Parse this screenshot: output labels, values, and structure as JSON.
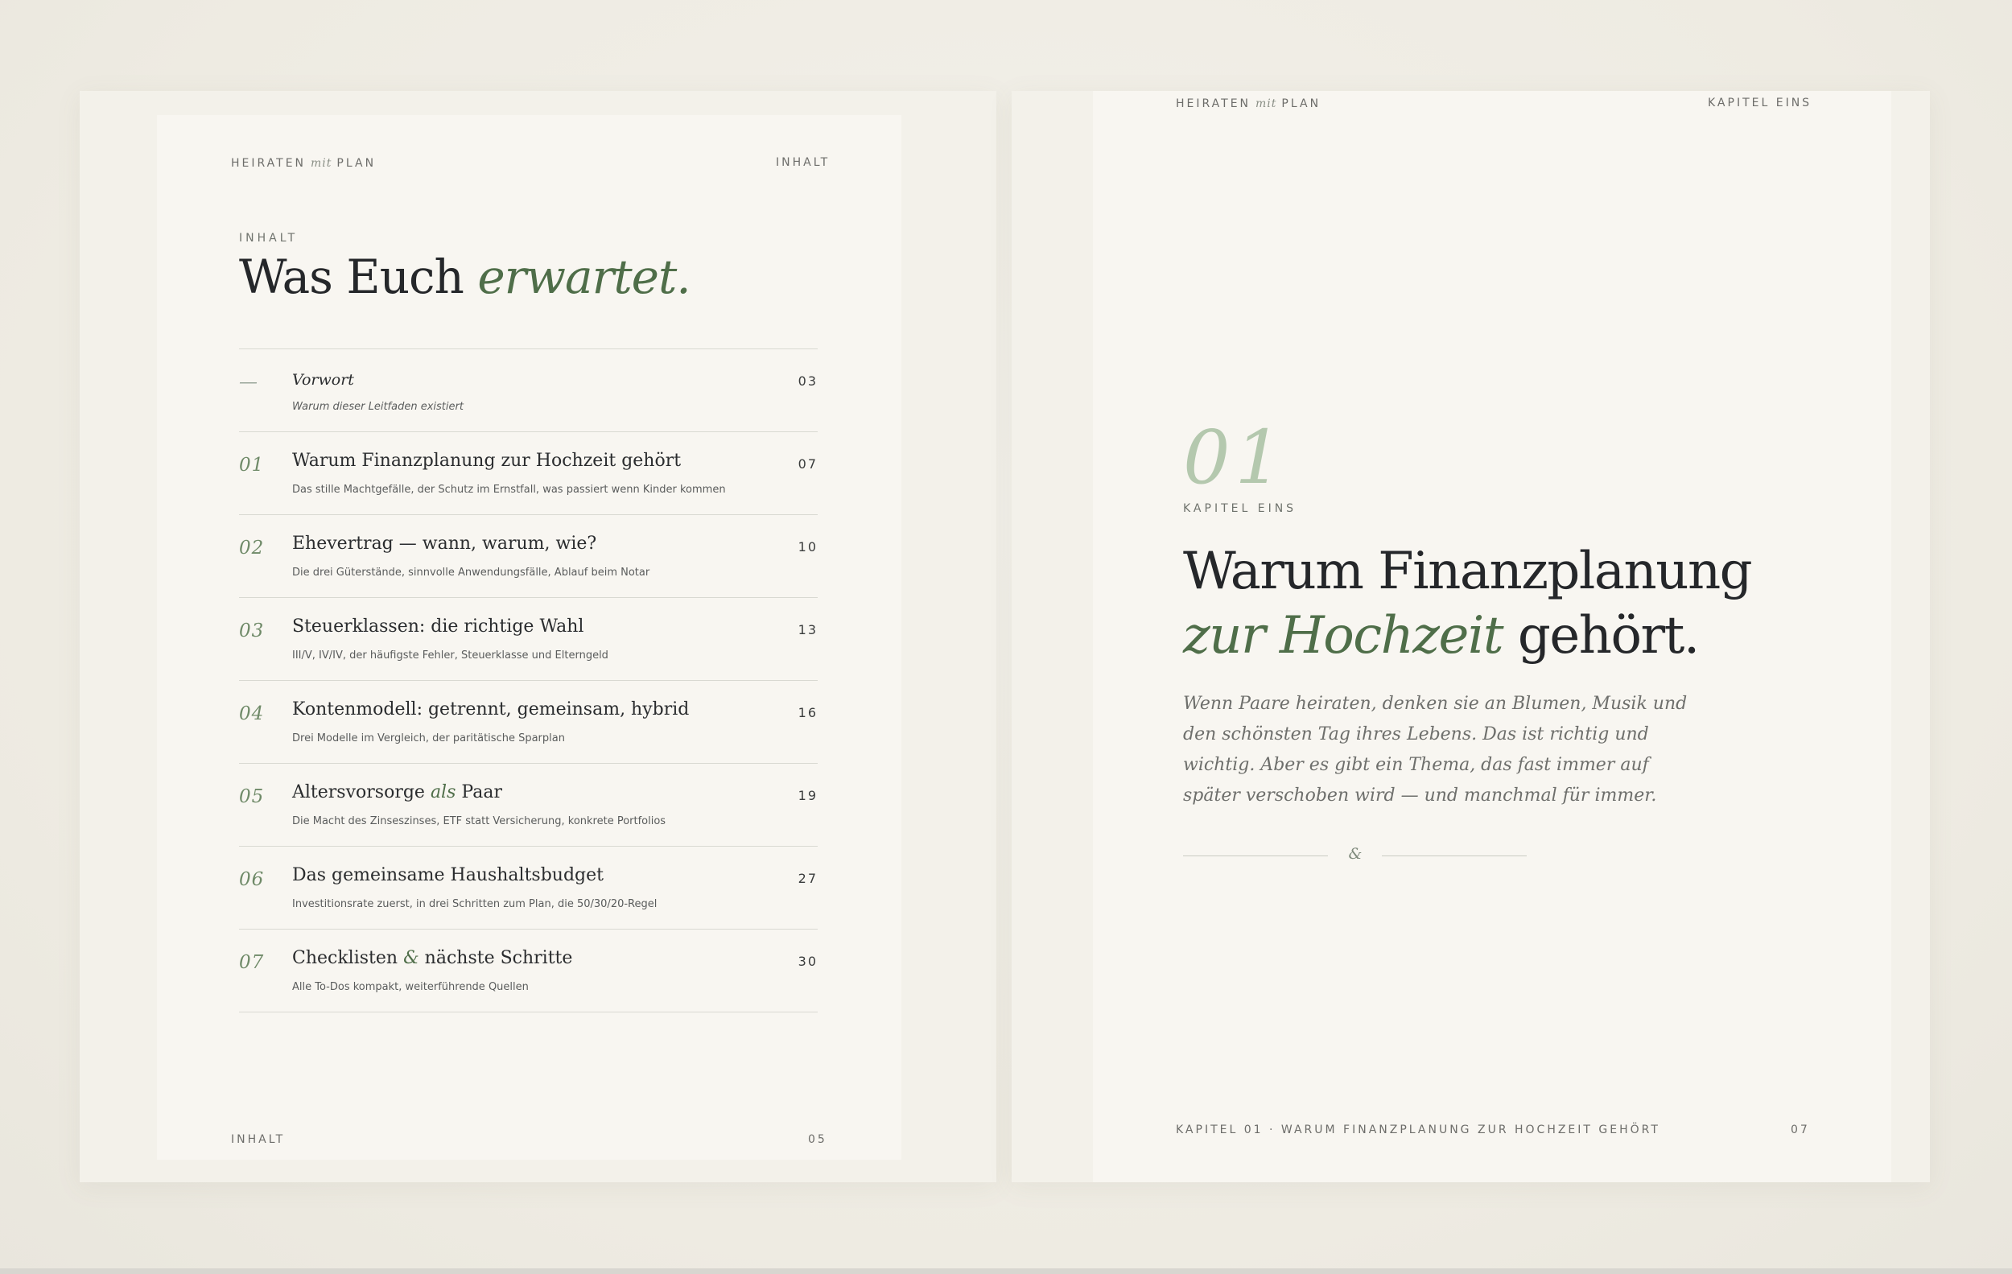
{
  "left_page": {
    "header_brand_a": "HEIRATEN",
    "header_brand_mit": "mit",
    "header_brand_b": "PLAN",
    "header_section": "INHALT",
    "eyebrow": "INHALT",
    "title_main": "Was Euch",
    "title_accent": "erwartet.",
    "footer_left": "INHALT",
    "footer_page": "05"
  },
  "toc": [
    {
      "num": "—",
      "title": "Vorwort",
      "subtitle": "Warum dieser Leitfaden existiert",
      "page": "03"
    },
    {
      "num": "01",
      "title": "Warum Finanzplanung zur Hochzeit gehört",
      "subtitle": "Das stille Machtgefälle, der Schutz im Ernstfall, was passiert wenn Kinder kommen",
      "page": "07"
    },
    {
      "num": "02",
      "title": "Ehevertrag — wann, warum, wie?",
      "subtitle": "Die drei Güterstände, sinnvolle Anwendungsfälle, Ablauf beim Notar",
      "page": "10"
    },
    {
      "num": "03",
      "title": "Steuerklassen: die richtige Wahl",
      "subtitle": "III/V, IV/IV, der häufigste Fehler, Steuerklasse und Elterngeld",
      "page": "13"
    },
    {
      "num": "04",
      "title": "Kontenmodell: getrennt, gemeinsam, hybrid",
      "subtitle": "Drei Modelle im Vergleich, der paritätische Sparplan",
      "page": "16"
    },
    {
      "num": "05",
      "title_a": "Altersvorsorge",
      "title_em": "als",
      "title_b": "Paar",
      "subtitle": "Die Macht des Zinseszinses, ETF statt Versicherung, konkrete Portfolios",
      "page": "19"
    },
    {
      "num": "06",
      "title": "Das gemeinsame Haushaltsbudget",
      "subtitle": "Investitionsrate zuerst, in drei Schritten zum Plan, die 50/30/20-Regel",
      "page": "27"
    },
    {
      "num": "07",
      "title_a": "Checklisten",
      "title_em": "&",
      "title_b": "nächste Schritte",
      "subtitle": "Alle To-Dos kompakt, weiterführende Quellen",
      "page": "30"
    }
  ],
  "right_page": {
    "header_brand_a": "HEIRATEN",
    "header_brand_mit": "mit",
    "header_brand_b": "PLAN",
    "header_chapter": "KAPITEL EINS",
    "chapter_number": "01",
    "chapter_eyebrow": "KAPITEL EINS",
    "heading_line1": "Warum Finanzplanung",
    "heading_accent": "zur Hochzeit",
    "heading_end": "gehört.",
    "intro": "Wenn Paare heiraten, denken sie an Blumen, Musik und den schönsten Tag ihres Lebens. Das ist richtig und wichtig. Aber es gibt ein Thema, das fast immer auf später verschoben wird — und manchmal für immer.",
    "ornament": "&",
    "footer_left": "KAPITEL 01 · WARUM FINANZPLANUNG ZUR HOCHZEIT GEHÖRT",
    "footer_page": "07"
  },
  "colors": {
    "background": "#efede6",
    "paper": "#f8f6f1",
    "ink": "#25272a",
    "accent_green": "#4f6e49",
    "chapter_number_green": "#b4c8ae"
  }
}
